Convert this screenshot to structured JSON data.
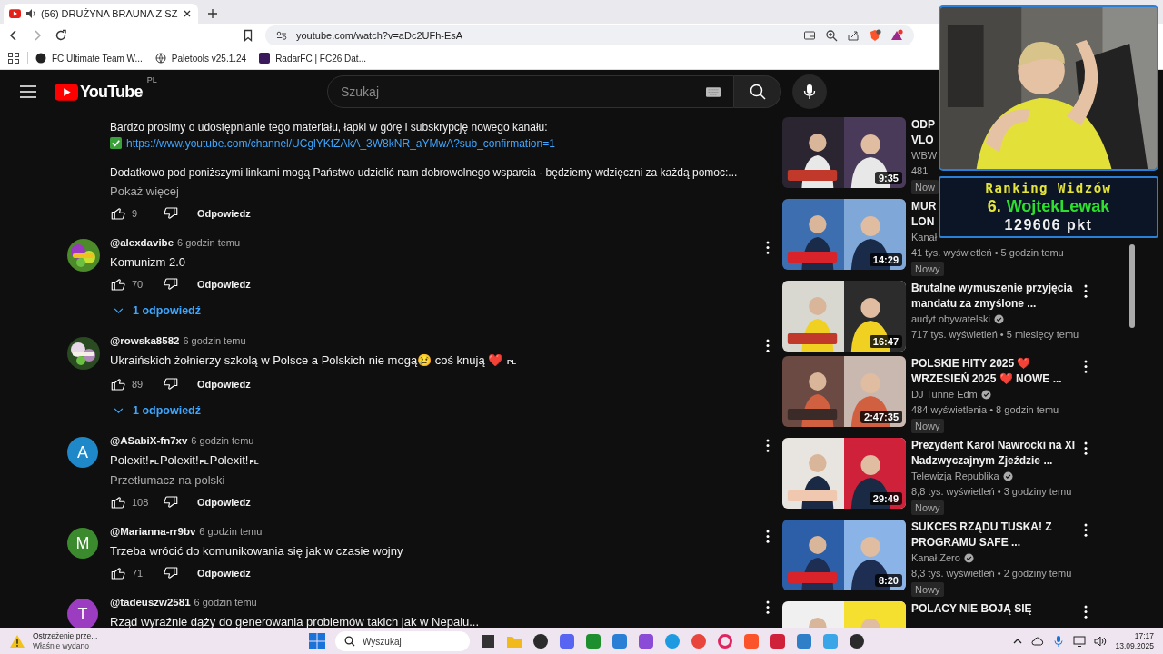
{
  "browser": {
    "tab_title": "(56) DRUŻYNA BRAUNA Z SZ",
    "url": "youtube.com/watch?v=aDc2UFh-EsA",
    "bookmarks": [
      {
        "label": "FC Ultimate Team W..."
      },
      {
        "label": "Paletools v25.1.24"
      },
      {
        "label": "RadarFC | FC26 Dat..."
      }
    ]
  },
  "youtube": {
    "logo": "YouTube",
    "region": "PL",
    "search_placeholder": "Szukaj"
  },
  "comments": [
    {
      "kind": "continued",
      "paragraphs": [
        "Bardzo prosimy o udostępnianie tego materiału, łapki w górę i subskrypcję nowego kanału:"
      ],
      "link": "https://www.youtube.com/channel/UCglYKfZAkA_3W8kNR_aYMwA?sub_confirmation=1",
      "after": "Dodatkowo pod poniższymi linkami mogą Państwo udzielić nam dobrowolnego wsparcia - będziemy wdzięczni za każdą pomoc:...",
      "show_more": "Pokaż więcej",
      "likes": "9",
      "reply": "Odpowiedz"
    },
    {
      "kind": "comment",
      "author": "@alexdavibe",
      "time": "6 godzin temu",
      "text": "Komunizm 2.0",
      "likes": "70",
      "reply": "Odpowiedz",
      "replies": "1 odpowiedź"
    },
    {
      "kind": "comment",
      "author": "@rowska8582",
      "time": "6 godzin temu",
      "text": "Ukraińskich żołnierzy szkolą w Polsce a Polskich nie mogą😢 coś knują ❤️ $_{PL}$",
      "likes": "89",
      "reply": "Odpowiedz",
      "replies": "1 odpowiedź"
    },
    {
      "kind": "comment",
      "avatar": {
        "kind": "letter",
        "initial": "A",
        "color": "#1e88c8"
      },
      "author": "@ASabiX-fn7xv",
      "time": "6 godzin temu",
      "text": "Polexit!$_{PL}$Polexit!$_{PL}$Polexit!$_{PL}$",
      "translate": "Przetłumacz na polski",
      "likes": "108",
      "reply": "Odpowiedz"
    },
    {
      "kind": "comment",
      "avatar": {
        "kind": "letter",
        "initial": "M",
        "color": "#3b8a2e"
      },
      "author": "@Marianna-rr9bv",
      "time": "6 godzin temu",
      "text": "Trzeba wrócić do komunikowania się jak w czasie wojny",
      "likes": "71",
      "reply": "Odpowiedz"
    },
    {
      "kind": "comment",
      "avatar": {
        "kind": "letter",
        "initial": "T",
        "color": "#9c3cc0"
      },
      "author": "@tadeuszw2581",
      "time": "6 godzin temu",
      "text": "Rząd wyraźnie dąży do generowania problemów takich jak w Nepalu..."
    }
  ],
  "videos": [
    {
      "duration": "9:35",
      "title_lines": [
        "ODP",
        "VLO"
      ],
      "channel": "WBW",
      "meta": "481",
      "badge": "Now"
    },
    {
      "duration": "14:29",
      "title_lines": [
        "MUR",
        "LON"
      ],
      "channel": "Kanał",
      "meta": "41 tys. wyświetleń • 5 godzin temu",
      "badge": "Nowy"
    },
    {
      "duration": "16:47",
      "title_lines": [
        "Brutalne wymuszenie przyjęcia",
        "mandatu za zmyślone ..."
      ],
      "channel": "audyt obywatelski",
      "verified": true,
      "meta": "717 tys. wyświetleń • 5 miesięcy temu"
    },
    {
      "duration": "2:47:35",
      "title_lines": [
        "POLSKIE HITY 2025 ❤️",
        "WRZESIEŃ 2025 ❤️ NOWE ..."
      ],
      "channel": "DJ Tunne Edm",
      "verified": true,
      "meta": "484 wyświetlenia • 8 godzin temu",
      "badge": "Nowy"
    },
    {
      "duration": "29:49",
      "title_lines": [
        "Prezydent Karol Nawrocki na XI",
        "Nadzwyczajnym Zjeździe ..."
      ],
      "channel": "Telewizja Republika",
      "verified": true,
      "meta": "8,8 tys. wyświetleń • 3 godziny temu",
      "badge": "Nowy"
    },
    {
      "duration": "8:20",
      "title_lines": [
        "SUKCES RZĄDU TUSKA! Z",
        "PROGRAMU SAFE ..."
      ],
      "channel": "Kanał Zero",
      "verified": true,
      "meta": "8,3 tys. wyświetleń • 2 godziny temu",
      "badge": "Nowy"
    },
    {
      "title_lines": [
        "POLACY NIE BOJĄ SIĘ"
      ]
    }
  ],
  "stream_overlay": {
    "title": "Ranking Widzów",
    "rank": "6.",
    "name": "WojtekLewak",
    "points": "129606 pkt"
  },
  "taskbar": {
    "alert_title": "Ostrzeżenie prze...",
    "alert_subtitle": "Właśnie wydano",
    "search_placeholder": "Wyszukaj",
    "time": "17:17",
    "date": "13.09.2025"
  }
}
